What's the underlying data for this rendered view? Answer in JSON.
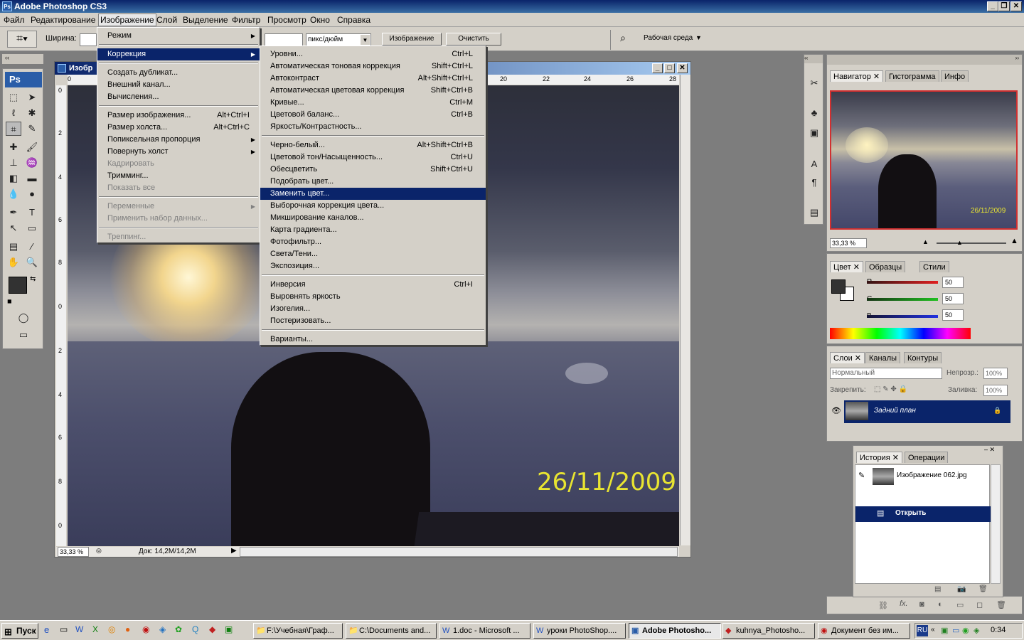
{
  "app": {
    "title": "Adobe Photoshop CS3",
    "ps_badge": "Ps"
  },
  "menubar": [
    "Файл",
    "Редактирование",
    "Изображение",
    "Слой",
    "Выделение",
    "Фильтр",
    "Просмотр",
    "Окно",
    "Справка"
  ],
  "options": {
    "width_label": "Ширина:",
    "units": "пикс/дюйм",
    "front_image_button": "Изображение",
    "clear_button": "Очистить",
    "workspace_label": "Рабочая среда"
  },
  "document": {
    "title": "Изобр",
    "zoom": "33,33 %",
    "doc_info": "Док: 14,2M/14,2M",
    "date_stamp": "26/11/2009",
    "ruler_top": [
      "0",
      "20",
      "22",
      "24",
      "26",
      "28"
    ],
    "ruler_left": [
      "0",
      "2",
      "4",
      "6",
      "8",
      "0",
      "2",
      "4",
      "6",
      "8",
      "0"
    ]
  },
  "image_menu": [
    {
      "label": "Режим",
      "submenu": true
    },
    {
      "sep": true
    },
    {
      "label": "Коррекция",
      "submenu": true,
      "selected": true
    },
    {
      "sep": true
    },
    {
      "label": "Создать дубликат..."
    },
    {
      "label": "Внешний канал..."
    },
    {
      "label": "Вычисления..."
    },
    {
      "sep": true
    },
    {
      "label": "Размер изображения...",
      "shortcut": "Alt+Ctrl+I"
    },
    {
      "label": "Размер холста...",
      "shortcut": "Alt+Ctrl+C"
    },
    {
      "label": "Попиксельная пропорция",
      "submenu": true
    },
    {
      "label": "Повернуть холст",
      "submenu": true
    },
    {
      "label": "Кадрировать",
      "disabled": true
    },
    {
      "label": "Тримминг..."
    },
    {
      "label": "Показать все",
      "disabled": true
    },
    {
      "sep": true
    },
    {
      "label": "Переменные",
      "submenu": true,
      "disabled": true
    },
    {
      "label": "Применить набор данных...",
      "disabled": true
    },
    {
      "sep": true
    },
    {
      "label": "Треппинг...",
      "disabled": true
    }
  ],
  "adjust_menu": [
    {
      "label": "Уровни...",
      "shortcut": "Ctrl+L"
    },
    {
      "label": "Автоматическая тоновая коррекция",
      "shortcut": "Shift+Ctrl+L"
    },
    {
      "label": "Автоконтраст",
      "shortcut": "Alt+Shift+Ctrl+L"
    },
    {
      "label": "Автоматическая цветовая коррекция",
      "shortcut": "Shift+Ctrl+B"
    },
    {
      "label": "Кривые...",
      "shortcut": "Ctrl+M"
    },
    {
      "label": "Цветовой баланс...",
      "shortcut": "Ctrl+B"
    },
    {
      "label": "Яркость/Контрастность..."
    },
    {
      "sep": true
    },
    {
      "label": "Черно-белый...",
      "shortcut": "Alt+Shift+Ctrl+B"
    },
    {
      "label": "Цветовой тон/Насыщенность...",
      "shortcut": "Ctrl+U"
    },
    {
      "label": "Обесцветить",
      "shortcut": "Shift+Ctrl+U"
    },
    {
      "label": "Подобрать цвет..."
    },
    {
      "label": "Заменить цвет...",
      "selected": true
    },
    {
      "label": "Выборочная коррекция цвета..."
    },
    {
      "label": "Микширование каналов..."
    },
    {
      "label": "Карта градиента..."
    },
    {
      "label": "Фотофильтр..."
    },
    {
      "label": "Света/Тени..."
    },
    {
      "label": "Экспозиция..."
    },
    {
      "sep": true
    },
    {
      "label": "Инверсия",
      "shortcut": "Ctrl+I"
    },
    {
      "label": "Выровнять яркость"
    },
    {
      "label": "Изогелия..."
    },
    {
      "label": "Постеризовать..."
    },
    {
      "sep": true
    },
    {
      "label": "Варианты..."
    }
  ],
  "navigator": {
    "tabs": [
      "Навигатор",
      "Гистограмма",
      "Инфо"
    ],
    "zoom": "33,33 %",
    "date_stamp": "26/11/2009"
  },
  "color_panel": {
    "tabs": [
      "Цвет",
      "Образцы",
      "Стили"
    ],
    "channels": [
      {
        "name": "R",
        "value": "50",
        "color": "#e02020"
      },
      {
        "name": "G",
        "value": "50",
        "color": "#20c020"
      },
      {
        "name": "B",
        "value": "50",
        "color": "#2030e0"
      }
    ]
  },
  "layers": {
    "tabs": [
      "Слои",
      "Каналы",
      "Контуры"
    ],
    "blend_mode": "Нормальный",
    "opacity_label": "Непрозр.:",
    "opacity": "100%",
    "lock_label": "Закрепить:",
    "fill_label": "Заливка:",
    "fill": "100%",
    "layer_name": "Задний план"
  },
  "history": {
    "tabs": [
      "История",
      "Операции"
    ],
    "snapshot": "Изображение 062.jpg",
    "step": "Открыть"
  },
  "taskbar": {
    "start": "Пуск",
    "tasks": [
      "F:\\Учебная\\Граф...",
      "C:\\Documents and...",
      "1.doc - Microsoft ...",
      "уроки PhotoShop....",
      "Adobe Photosho...",
      "kuhnya_Photosho...",
      "Документ без им..."
    ],
    "lang": "RU",
    "clock": "0:34"
  }
}
